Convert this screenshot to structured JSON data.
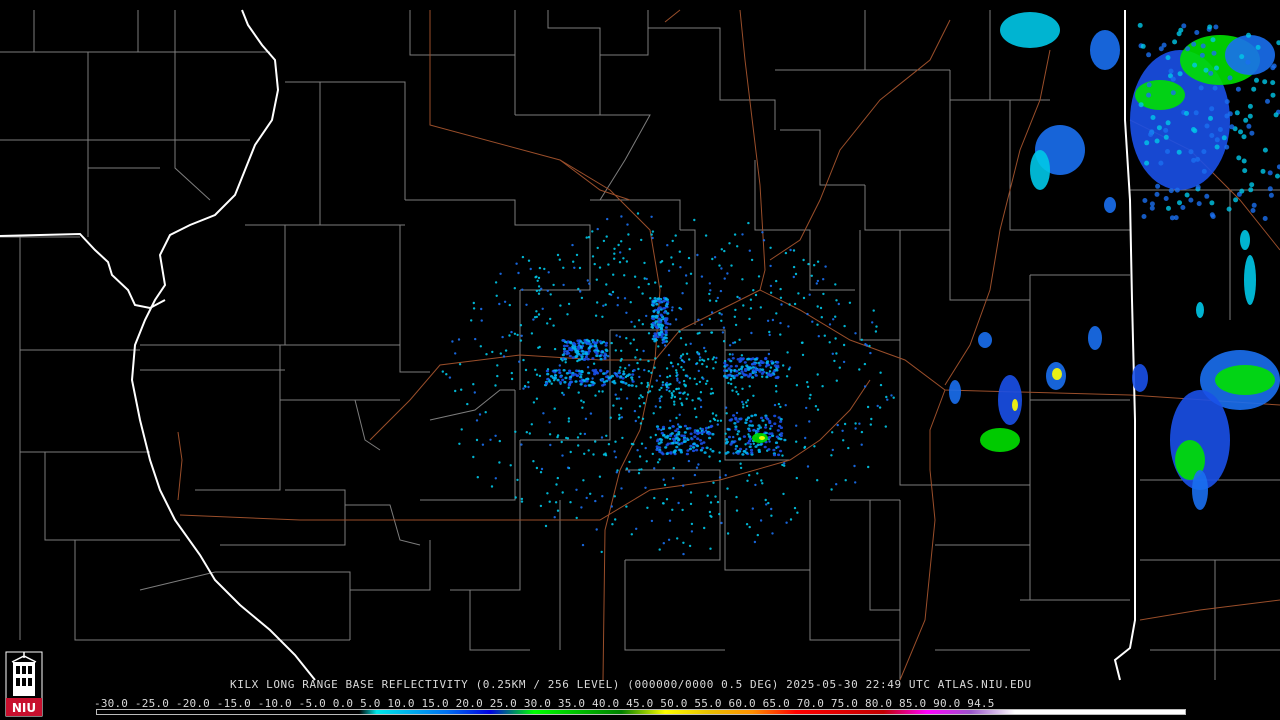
{
  "product": {
    "caption": "KILX LONG RANGE BASE REFLECTIVITY (0.25KM / 256 LEVEL) (000000/0000 0.5 DEG) 2025-05-30 22:49 UTC  ATLAS.NIU.EDU"
  },
  "logo": {
    "text": "NIU",
    "icon": "niu-tower-logo-icon"
  },
  "color_scale": {
    "labels": "-30.0 -25.0 -20.0 -15.0 -10.0 -5.0  0.0   5.0  10.0  15.0  20.0  25.0  30.0  35.0  40.0  45.0  50.0  55.0  60.0  65.0  70.0  75.0  80.0  85.0  90.0  94.5",
    "min_dbz": -30.0,
    "max_dbz": 94.5,
    "stops": [
      {
        "dbz": -30,
        "color": "#000000"
      },
      {
        "dbz": 0,
        "color": "#000000"
      },
      {
        "dbz": 2,
        "color": "#00e8e8"
      },
      {
        "dbz": 10,
        "color": "#0070f0"
      },
      {
        "dbz": 15,
        "color": "#0000e0"
      },
      {
        "dbz": 20,
        "color": "#00ff00"
      },
      {
        "dbz": 30,
        "color": "#008000"
      },
      {
        "dbz": 35,
        "color": "#ffff00"
      },
      {
        "dbz": 40,
        "color": "#e7c000"
      },
      {
        "dbz": 45,
        "color": "#ff9000"
      },
      {
        "dbz": 50,
        "color": "#ff0000"
      },
      {
        "dbz": 60,
        "color": "#c00000"
      },
      {
        "dbz": 65,
        "color": "#ff00ff"
      },
      {
        "dbz": 70,
        "color": "#9955c9"
      },
      {
        "dbz": 75,
        "color": "#ffffff"
      },
      {
        "dbz": 94.5,
        "color": "#ffffff"
      }
    ]
  },
  "map_colors": {
    "background": "#000000",
    "state_border": "#ffffff",
    "county_border": "#8a8a8a",
    "highway": "#a0522d"
  }
}
